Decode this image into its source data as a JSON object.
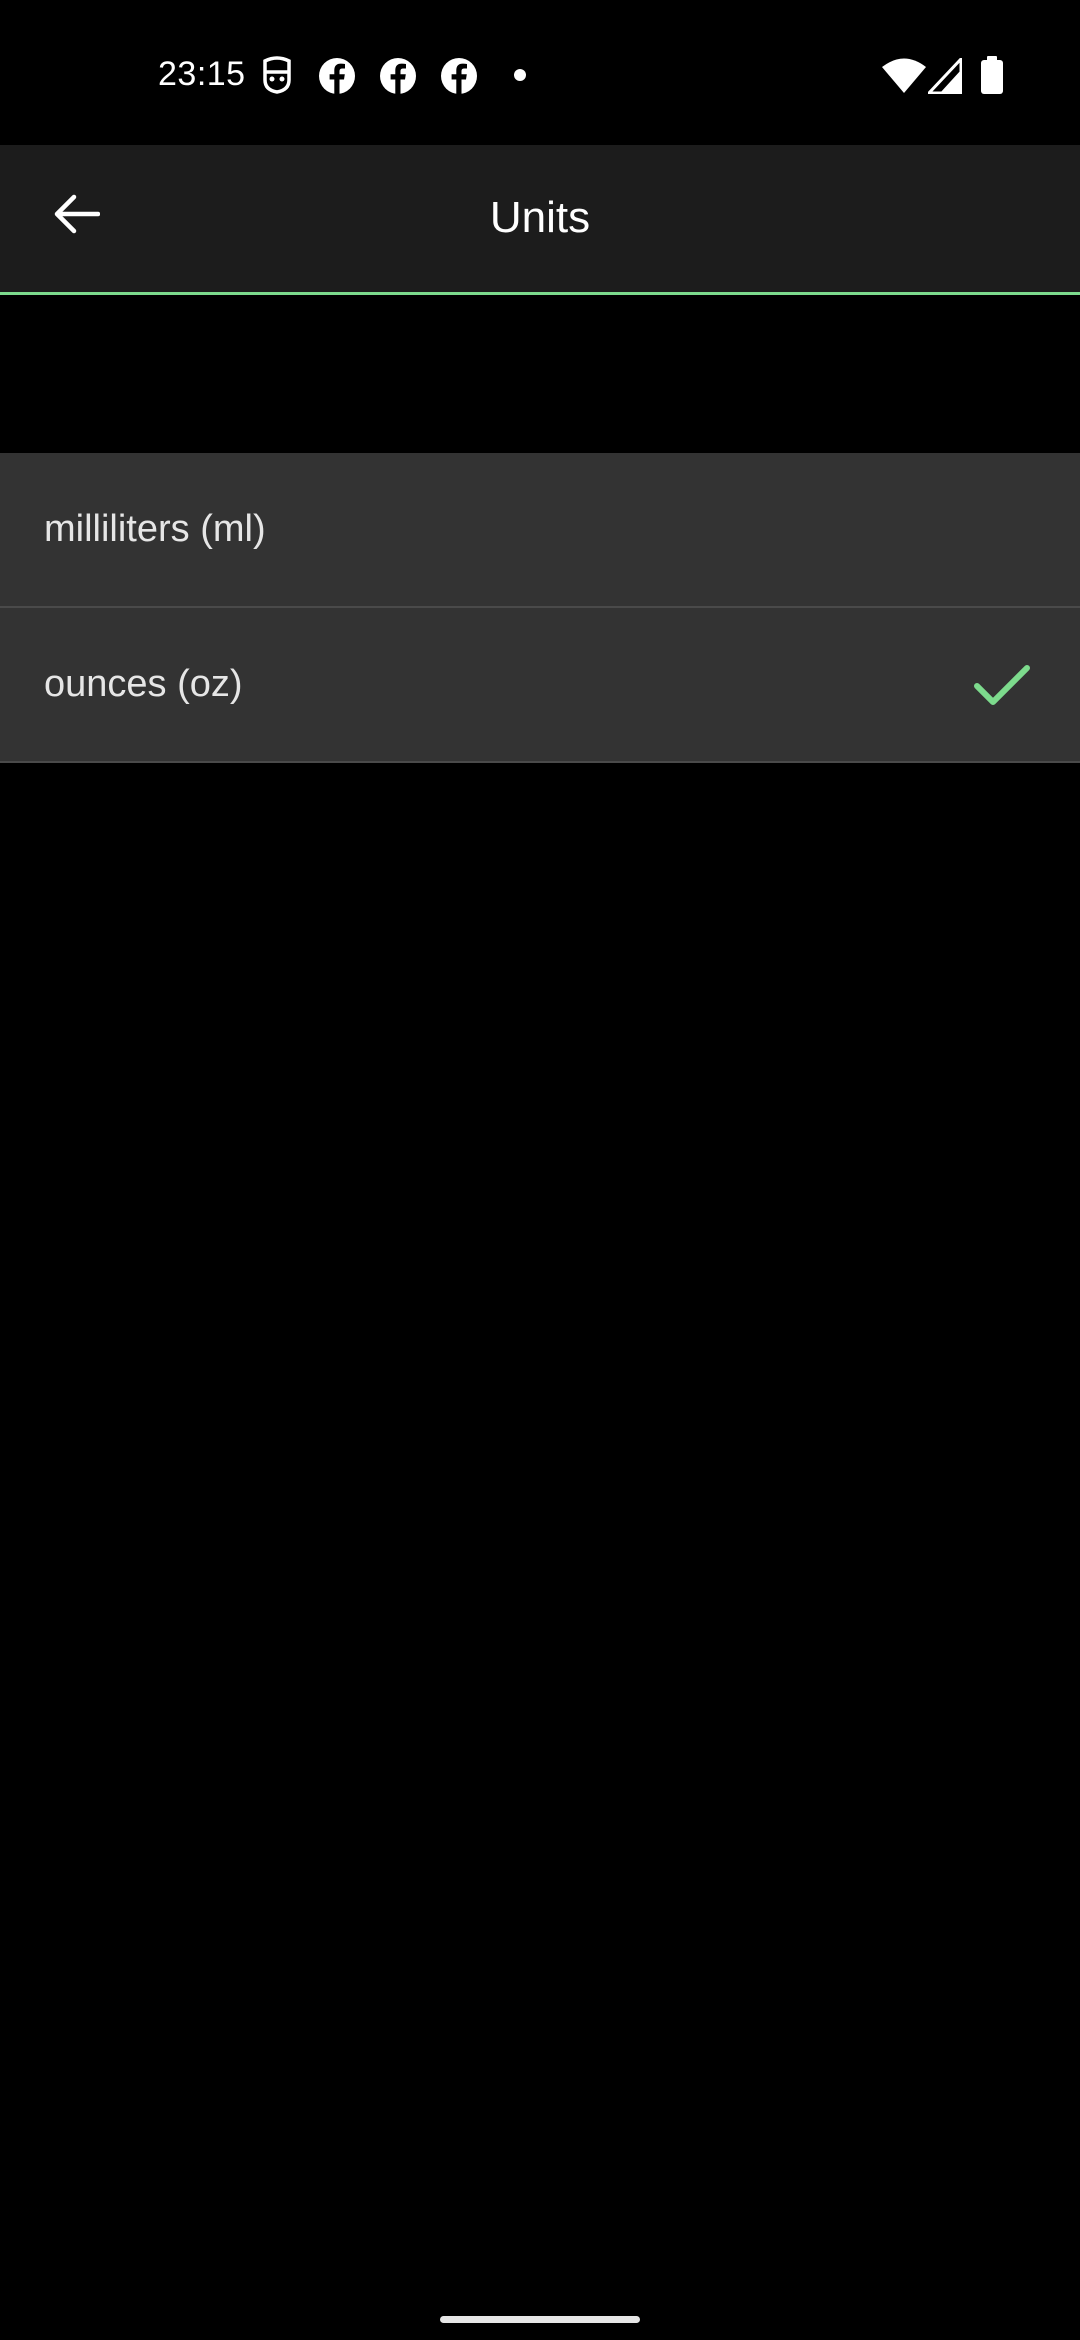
{
  "status_bar": {
    "time": "23:15",
    "notification_icons": [
      "shield-face-icon",
      "facebook-icon",
      "facebook-icon",
      "facebook-icon",
      "dot-icon"
    ],
    "system_icons": [
      "wifi-icon",
      "cellular-signal-icon",
      "battery-icon"
    ]
  },
  "app_bar": {
    "title": "Units",
    "back_icon": "arrow-back-icon"
  },
  "units_list": {
    "items": [
      {
        "label": "milliliters (ml)",
        "selected": false
      },
      {
        "label": "ounces (oz)",
        "selected": true
      }
    ]
  },
  "colors": {
    "accent": "#7ddb8d",
    "background": "#000000",
    "app_bar": "#1c1c1c",
    "list_item": "#333333"
  }
}
